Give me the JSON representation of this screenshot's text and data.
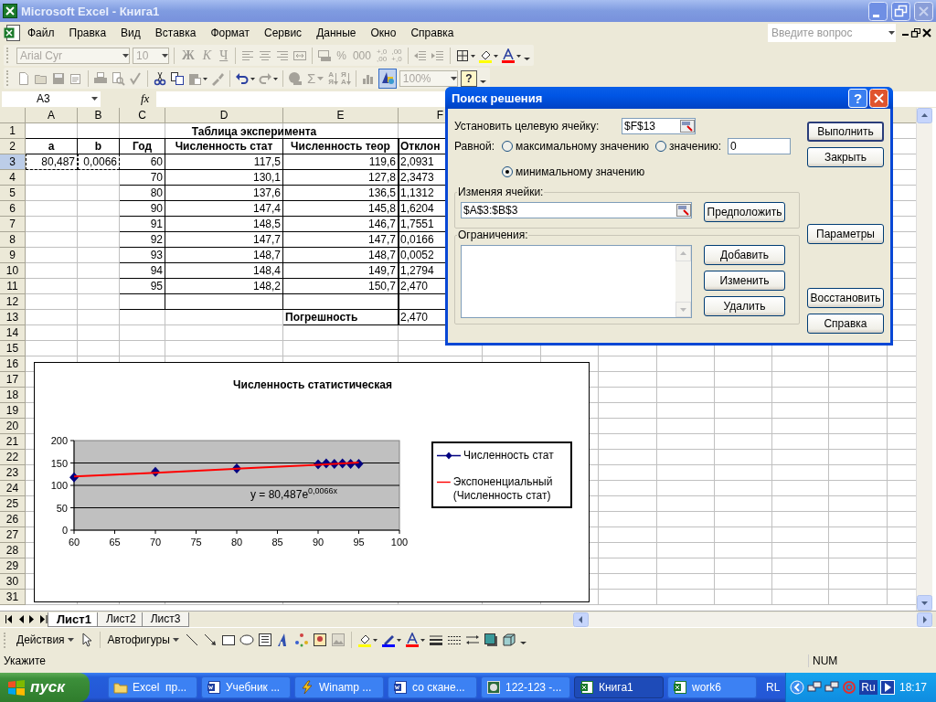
{
  "window": {
    "title": "Microsoft Excel - Книга1"
  },
  "menu": [
    "Файл",
    "Правка",
    "Вид",
    "Вставка",
    "Формат",
    "Сервис",
    "Данные",
    "Окно",
    "Справка"
  ],
  "help_search": {
    "placeholder": "Введите вопрос"
  },
  "formatting_toolbar": {
    "font": "Arial Cyr",
    "font_size": "10",
    "style_buttons": [
      "Ж",
      "К",
      "Ч"
    ],
    "number_buttons": [
      "%",
      "000"
    ],
    "decimal_buttons": [
      {
        "top": "+,0",
        "bottom": ",00"
      },
      {
        "top": ",00",
        "bottom": "+,0"
      }
    ]
  },
  "standard_toolbar": {
    "sum": "Σ",
    "sort_buttons": [
      {
        "top": "А",
        "bottom": "Я"
      },
      {
        "top": "Я",
        "bottom": "А"
      }
    ],
    "zoom": "100%",
    "help": "?"
  },
  "formula_bar": {
    "name_box": "A3",
    "function_label": "fx"
  },
  "sheet": {
    "columns": [
      "A",
      "B",
      "C",
      "D",
      "E",
      "F"
    ],
    "rows": [
      {
        "number": "1",
        "kind": "title",
        "selected": false,
        "copied": false,
        "title": "Таблица эксперимента"
      },
      {
        "number": "2",
        "kind": "header",
        "selected": false,
        "copied": false,
        "a": "a",
        "b": "b",
        "c": "Год",
        "d": "Численность стат",
        "e": "Численность теор",
        "f": "Отклон"
      },
      {
        "number": "3",
        "kind": "data",
        "selected": true,
        "copied": true,
        "a": "80,487",
        "b": "0,0066",
        "c": "60",
        "d": "117,5",
        "e": "119,6",
        "f": "2,0931"
      },
      {
        "number": "4",
        "kind": "data",
        "selected": false,
        "copied": false,
        "c": "70",
        "d": "130,1",
        "e": "127,8",
        "f": "2,3473"
      },
      {
        "number": "5",
        "kind": "data",
        "selected": false,
        "copied": false,
        "c": "80",
        "d": "137,6",
        "e": "136,5",
        "f": "1,1312"
      },
      {
        "number": "6",
        "kind": "data",
        "selected": false,
        "copied": false,
        "c": "90",
        "d": "147,4",
        "e": "145,8",
        "f": "1,6204"
      },
      {
        "number": "7",
        "kind": "data",
        "selected": false,
        "copied": false,
        "c": "91",
        "d": "148,5",
        "e": "146,7",
        "f": "1,7551"
      },
      {
        "number": "8",
        "kind": "data",
        "selected": false,
        "copied": false,
        "c": "92",
        "d": "147,7",
        "e": "147,7",
        "f": "0,0166"
      },
      {
        "number": "9",
        "kind": "data",
        "selected": false,
        "copied": false,
        "c": "93",
        "d": "148,7",
        "e": "148,7",
        "f": "0,0052"
      },
      {
        "number": "10",
        "kind": "data",
        "selected": false,
        "copied": false,
        "c": "94",
        "d": "148,4",
        "e": "149,7",
        "f": "1,2794"
      },
      {
        "number": "11",
        "kind": "data",
        "selected": false,
        "copied": false,
        "c": "95",
        "d": "148,2",
        "e": "150,7",
        "f": "2,470"
      },
      {
        "number": "12",
        "kind": "data",
        "selected": false,
        "copied": false
      },
      {
        "number": "13",
        "kind": "summary",
        "selected": false,
        "copied": false,
        "e": "Погрешность",
        "f": "2,470"
      },
      {
        "number": "14",
        "kind": "empty",
        "selected": false,
        "copied": false
      },
      {
        "number": "15",
        "kind": "empty",
        "selected": false,
        "copied": false
      },
      {
        "number": "16",
        "kind": "empty",
        "selected": false,
        "copied": false
      },
      {
        "number": "17",
        "kind": "empty",
        "selected": false,
        "copied": false
      },
      {
        "number": "18",
        "kind": "empty",
        "selected": false,
        "copied": false
      },
      {
        "number": "19",
        "kind": "empty",
        "selected": false,
        "copied": false
      },
      {
        "number": "20",
        "kind": "empty",
        "selected": false,
        "copied": false
      },
      {
        "number": "21",
        "kind": "empty",
        "selected": false,
        "copied": false
      },
      {
        "number": "22",
        "kind": "empty",
        "selected": false,
        "copied": false
      },
      {
        "number": "23",
        "kind": "empty",
        "selected": false,
        "copied": false
      },
      {
        "number": "24",
        "kind": "empty",
        "selected": false,
        "copied": false
      },
      {
        "number": "25",
        "kind": "empty",
        "selected": false,
        "copied": false
      },
      {
        "number": "26",
        "kind": "empty",
        "selected": false,
        "copied": false
      },
      {
        "number": "27",
        "kind": "empty",
        "selected": false,
        "copied": false
      },
      {
        "number": "28",
        "kind": "empty",
        "selected": false,
        "copied": false
      },
      {
        "number": "29",
        "kind": "empty",
        "selected": false,
        "copied": false
      },
      {
        "number": "30",
        "kind": "empty",
        "selected": false,
        "copied": false
      },
      {
        "number": "31",
        "kind": "empty",
        "selected": false,
        "copied": false
      }
    ]
  },
  "chart": {
    "chart_data": {
      "type": "scatter",
      "title": "Численность статистическая",
      "x": [
        60,
        70,
        80,
        90,
        91,
        92,
        93,
        94,
        95
      ],
      "series": [
        {
          "name": "Численность стат",
          "color": "#000080",
          "values": [
            118,
            130,
            138,
            147,
            149,
            148,
            149,
            148,
            148
          ]
        },
        {
          "name": "Экспоненциальный (Численность стат)",
          "color": "#ff0000",
          "type": "line",
          "values": [
            120,
            128,
            137,
            146,
            147,
            148,
            149,
            150,
            151
          ]
        }
      ],
      "grid": true,
      "legend": true,
      "xlim": [
        60,
        100
      ],
      "ylim": [
        0,
        200
      ],
      "xticks": [
        60,
        65,
        70,
        75,
        80,
        85,
        90,
        95,
        100
      ],
      "yticks": [
        0,
        50,
        100,
        150,
        200
      ],
      "annotations": [
        {
          "text": "y = 80,487e$^{0,0066x}$"
        }
      ]
    }
  },
  "dialog": {
    "title": "Поиск решения",
    "help_button": "?",
    "target": {
      "label": "Установить целевую ячейку:",
      "value": "$F$13"
    },
    "equal_label": "Равной:",
    "options": [
      {
        "label": "максимальному значению",
        "selected": false
      },
      {
        "label": "значению:",
        "selected": false
      },
      {
        "label": "минимальному значению",
        "selected": true
      }
    ],
    "value_field": "0",
    "changing": {
      "label": "Изменяя ячейки:",
      "value": "$A$3:$B$3",
      "button": "Предположить"
    },
    "constraints": {
      "label": "Ограничения:",
      "buttons": [
        "Добавить",
        "Изменить",
        "Удалить"
      ]
    },
    "side_buttons": [
      {
        "label": "Выполнить",
        "default": true
      },
      {
        "label": "Закрыть",
        "default": false
      },
      {
        "label": "Параметры",
        "default": false
      },
      {
        "label": "Восстановить",
        "default": false
      },
      {
        "label": "Справка",
        "default": false
      }
    ]
  },
  "sheet_tabs": [
    {
      "label": "Лист1",
      "selected": true
    },
    {
      "label": "Лист2",
      "selected": false
    },
    {
      "label": "Лист3",
      "selected": false
    }
  ],
  "drawing_toolbar": {
    "actions": "Действия",
    "autoshapes": "Автофигуры"
  },
  "status_bar": {
    "message": "Укажите",
    "indicator": "NUM"
  },
  "taskbar": {
    "start": "пуск",
    "tasks": [
      {
        "label": "Excel  пр...",
        "selected": false
      },
      {
        "label": "Учебник ...",
        "selected": false
      },
      {
        "label": "Winamp ...",
        "selected": false
      },
      {
        "label": "со скане...",
        "selected": false
      },
      {
        "label": "122-123 -...",
        "selected": false
      },
      {
        "label": "Книга1",
        "selected": true
      },
      {
        "label": "work6",
        "selected": false
      }
    ],
    "language": "RL",
    "keyboard": "Ru",
    "time": "18:17"
  }
}
